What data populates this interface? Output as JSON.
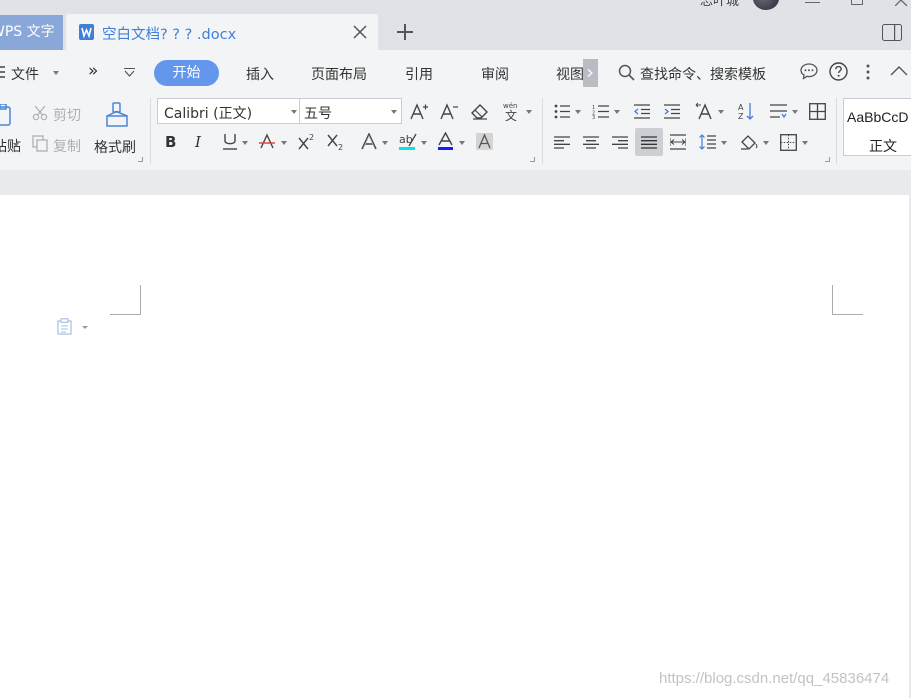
{
  "tabs": {
    "home_label": "WPS 文字",
    "doc_title": "空白文档? ? ? .docx",
    "user_name": "忘叶城"
  },
  "menu": {
    "file": "文件",
    "items": [
      "开始",
      "插入",
      "页面布局",
      "引用",
      "审阅",
      "视图"
    ],
    "search": "查找命令、搜索模板"
  },
  "ribbon": {
    "paste": "粘贴",
    "cut": "剪切",
    "copy": "复制",
    "format_painter": "格式刷",
    "font_name": "Calibri (正文)",
    "font_size": "五号",
    "style_preview": "AaBbCcD",
    "style_name": "正文"
  },
  "watermark": "https://blog.csdn.net/qq_45836474",
  "colors": {
    "accent": "#6496ec",
    "home_tab": "#8aa7d9",
    "doc_tab_text": "#3f7fd8",
    "highlight_color": "#00e5e5",
    "font_color": "#1a1aff"
  }
}
